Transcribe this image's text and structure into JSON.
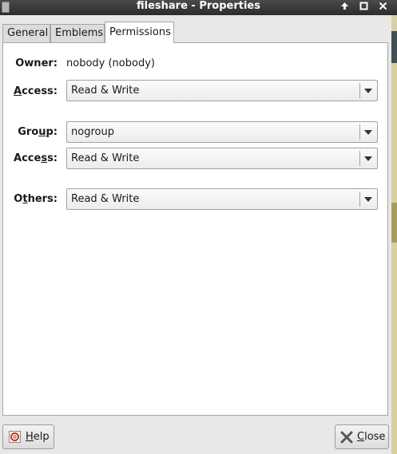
{
  "window": {
    "title": "fileshare - Properties"
  },
  "tabs": [
    {
      "label": "General"
    },
    {
      "label": "Emblems"
    },
    {
      "label": "Permissions"
    }
  ],
  "permissions": {
    "owner_label": "Owner:",
    "owner_value": "nobody (nobody)",
    "owner_access": {
      "label_a": "A",
      "label_rest": "ccess:",
      "value": "Read & Write"
    },
    "group": {
      "label_pre": "Gro",
      "label_u": "u",
      "label_post": "p:",
      "value": "nogroup"
    },
    "group_access": {
      "label_pre": "Acce",
      "label_u": "s",
      "label_post": "s:",
      "value": "Read & Write"
    },
    "others": {
      "label_pre": "O",
      "label_u": "t",
      "label_post": "hers:",
      "value": "Read & Write"
    }
  },
  "buttons": {
    "help": {
      "u": "H",
      "rest": "elp"
    },
    "close": {
      "u": "C",
      "rest": "lose"
    }
  },
  "icons": {
    "maximize": "up-arrow-icon",
    "restore": "restore-icon",
    "close": "close-icon",
    "help": "lifebuoy-icon",
    "close_button": "x-icon"
  }
}
